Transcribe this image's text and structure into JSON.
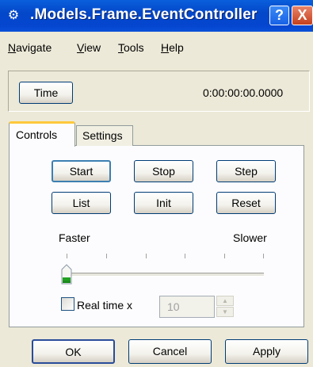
{
  "window": {
    "title": ".Models.Frame.EventController",
    "help_button": "?",
    "close_button": "X"
  },
  "menu": [
    {
      "first": "N",
      "rest": "avigate"
    },
    {
      "first": "V",
      "rest": "iew"
    },
    {
      "first": "T",
      "rest": "ools"
    },
    {
      "first": "H",
      "rest": "elp"
    }
  ],
  "time": {
    "button_label": "Time",
    "value": "0:00:00:00.0000"
  },
  "tabs": {
    "controls": "Controls",
    "settings": "Settings",
    "active": "Controls"
  },
  "controls": {
    "buttons": [
      "Start",
      "Stop",
      "Step",
      "List",
      "Init",
      "Reset"
    ],
    "speed": {
      "faster_label": "Faster",
      "slower_label": "Slower",
      "level": 0
    },
    "realtime": {
      "label": "Real time x",
      "checked": false,
      "value": "10"
    }
  },
  "dialog_buttons": {
    "ok": "OK",
    "cancel": "Cancel",
    "apply": "Apply"
  },
  "colors": {
    "title_bar": "#0348c9",
    "window_bg": "#ece9d8",
    "tab_highlight": "#ffc83c",
    "slider_thumb_accent": "#21a121"
  }
}
